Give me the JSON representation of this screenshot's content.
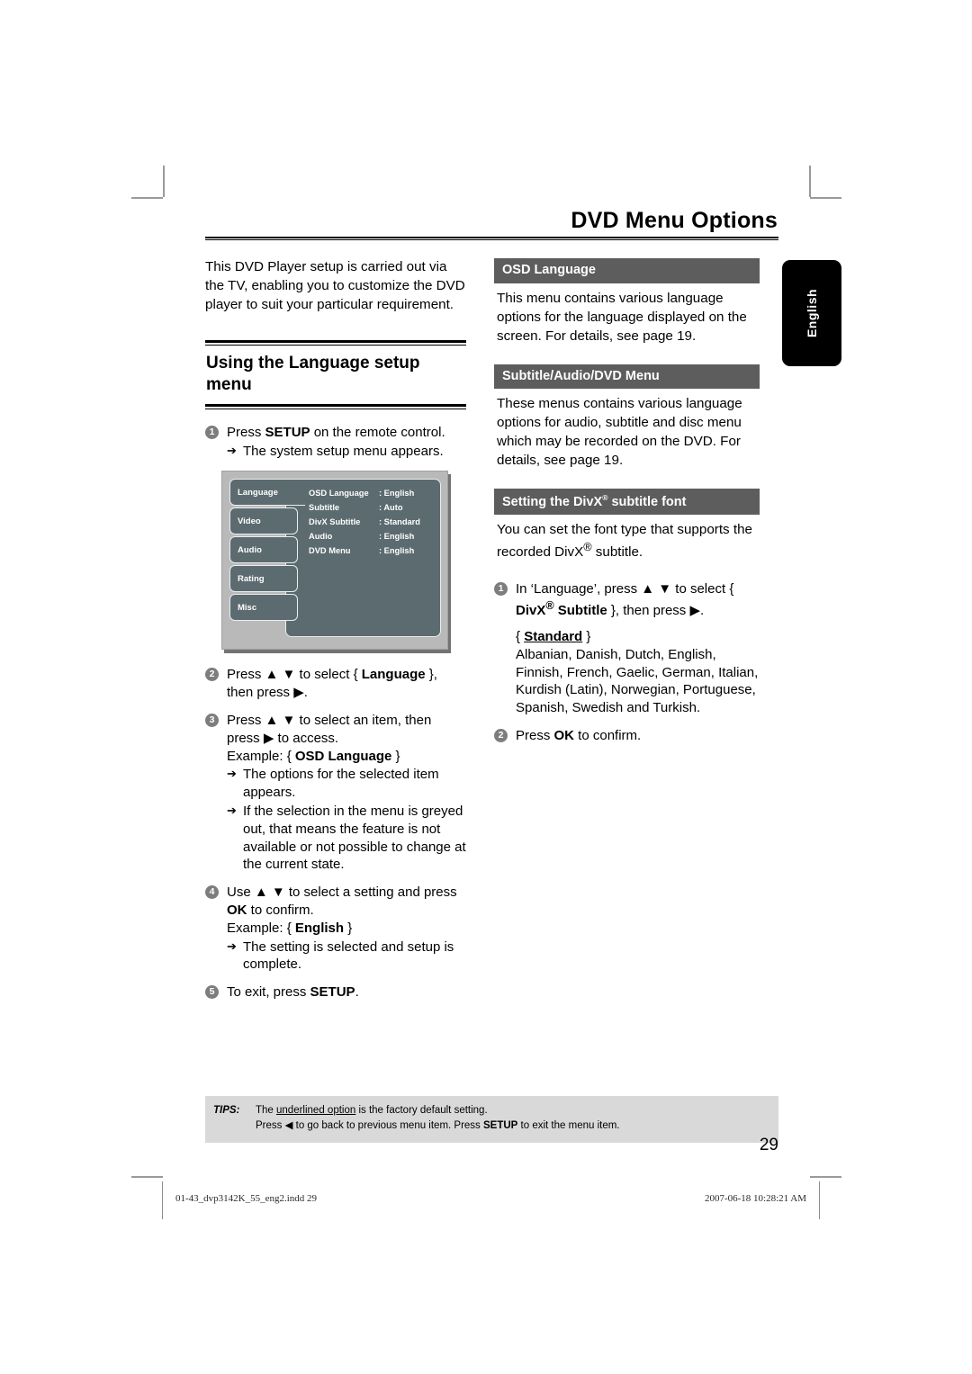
{
  "header": {
    "title": "DVD Menu Options"
  },
  "side_tab": {
    "label": "English"
  },
  "left_column": {
    "intro": "This DVD Player setup is carried out via the TV, enabling you to customize the DVD player to suit your particular requirement.",
    "section_heading": "Using the Language setup menu",
    "steps": [
      {
        "num": "1",
        "text_html": "Press <b>SETUP</b> on the remote control.",
        "subs": [
          "The system setup menu appears."
        ]
      },
      {
        "num": "2",
        "text_html": "Press ▲ ▼ to select { <b>Language</b> }, then press ▶.",
        "subs": []
      },
      {
        "num": "3",
        "text_html": "Press ▲ ▼ to select an item, then press ▶ to access.<br>Example: { <b>OSD Language</b> }",
        "subs": [
          "The options for the selected item appears.",
          "If the selection in the menu is greyed out, that means the feature is not available or not possible to change at the current state."
        ]
      },
      {
        "num": "4",
        "text_html": "Use ▲ ▼ to select a setting and press <b>OK</b> to confirm.<br>Example: { <b>English</b> }",
        "subs": [
          "The setting is selected and setup is complete."
        ]
      },
      {
        "num": "5",
        "text_html": "To exit, press <b>SETUP</b>.",
        "subs": []
      }
    ]
  },
  "osd_menu": {
    "tabs": [
      "Language",
      "Video",
      "Audio",
      "Rating",
      "Misc"
    ],
    "active_tab": "Language",
    "rows": [
      {
        "key": "OSD Language",
        "value": ": English"
      },
      {
        "key": "Subtitle",
        "value": ": Auto"
      },
      {
        "key": "DivX Subtitle",
        "value": ": Standard"
      },
      {
        "key": "Audio",
        "value": ": English"
      },
      {
        "key": "DVD Menu",
        "value": ": English"
      }
    ],
    "colors": {
      "frame": "#b9b9b9",
      "panel": "#5c6b70",
      "text": "#ffffff"
    }
  },
  "right_column": {
    "sections": [
      {
        "bar_html": "OSD Language",
        "body_html": "This menu contains various language options for the language displayed on the screen. For details, see page 19."
      },
      {
        "bar_html": "Subtitle/Audio/DVD Menu",
        "body_html": "These menus contains various language options for audio, subtitle and disc menu which may be recorded on the DVD. For details, see page 19."
      },
      {
        "bar_html": "Setting the DivX<sup>®</sup> subtitle font",
        "body_html": "You can set the font type that supports the recorded DivX<sup>®</sup> subtitle."
      }
    ],
    "steps": [
      {
        "num": "1",
        "text_html": "In ‘Language’, press ▲ ▼ to select { <b>DivX<sup>®</sup> Subtitle</b> }, then press ▶.",
        "extra_html": "{ <b><span class=\"under\">Standard</span></b> }<br>Albanian, Danish, Dutch, English, Finnish, French, Gaelic, German, Italian, Kurdish (Latin), Norwegian, Portuguese, Spanish, Swedish and Turkish."
      },
      {
        "num": "2",
        "text_html": "Press <b>OK</b> to confirm.",
        "extra_html": ""
      }
    ]
  },
  "tips": {
    "label": "TIPS:",
    "line1_html": "The <span class=\"under\">underlined option</span> is the factory default setting.",
    "line2_html": "Press ◀ to go back to previous menu item. Press <b>SETUP</b> to exit the menu item."
  },
  "page_number": "29",
  "footer": {
    "file": "01-43_dvp3142K_55_eng2.indd   29",
    "timestamp": "2007-06-18   10:28:21 AM"
  },
  "colors": {
    "section_bar": "#5d5d5d",
    "tips_bg": "#d9d9d9",
    "bullet": "#7d7d7d"
  }
}
